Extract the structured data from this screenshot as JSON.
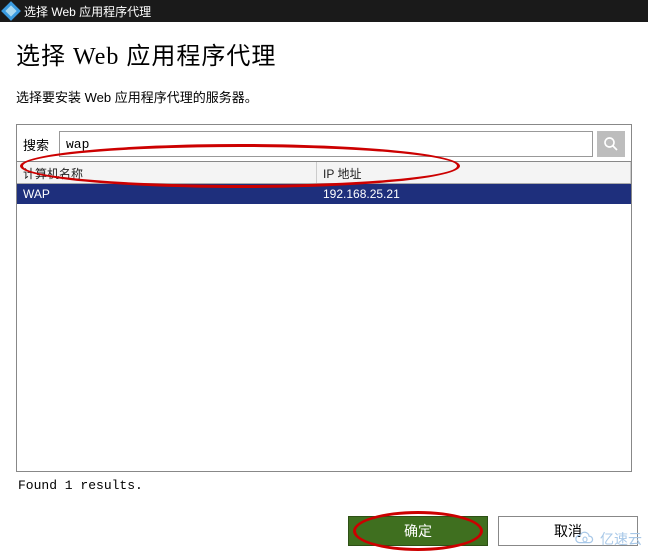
{
  "window": {
    "title": "选择 Web 应用程序代理"
  },
  "dialog": {
    "heading": "选择 Web 应用程序代理",
    "instruction": "选择要安装 Web 应用程序代理的服务器。"
  },
  "search": {
    "label": "搜索",
    "value": "wap"
  },
  "table": {
    "columns": {
      "name": "计算机名称",
      "ip": "IP 地址"
    },
    "rows": [
      {
        "name": "WAP",
        "ip": "192.168.25.21"
      }
    ]
  },
  "status": "Found 1 results.",
  "buttons": {
    "ok": "确定",
    "cancel": "取消"
  },
  "watermark": "亿速云"
}
